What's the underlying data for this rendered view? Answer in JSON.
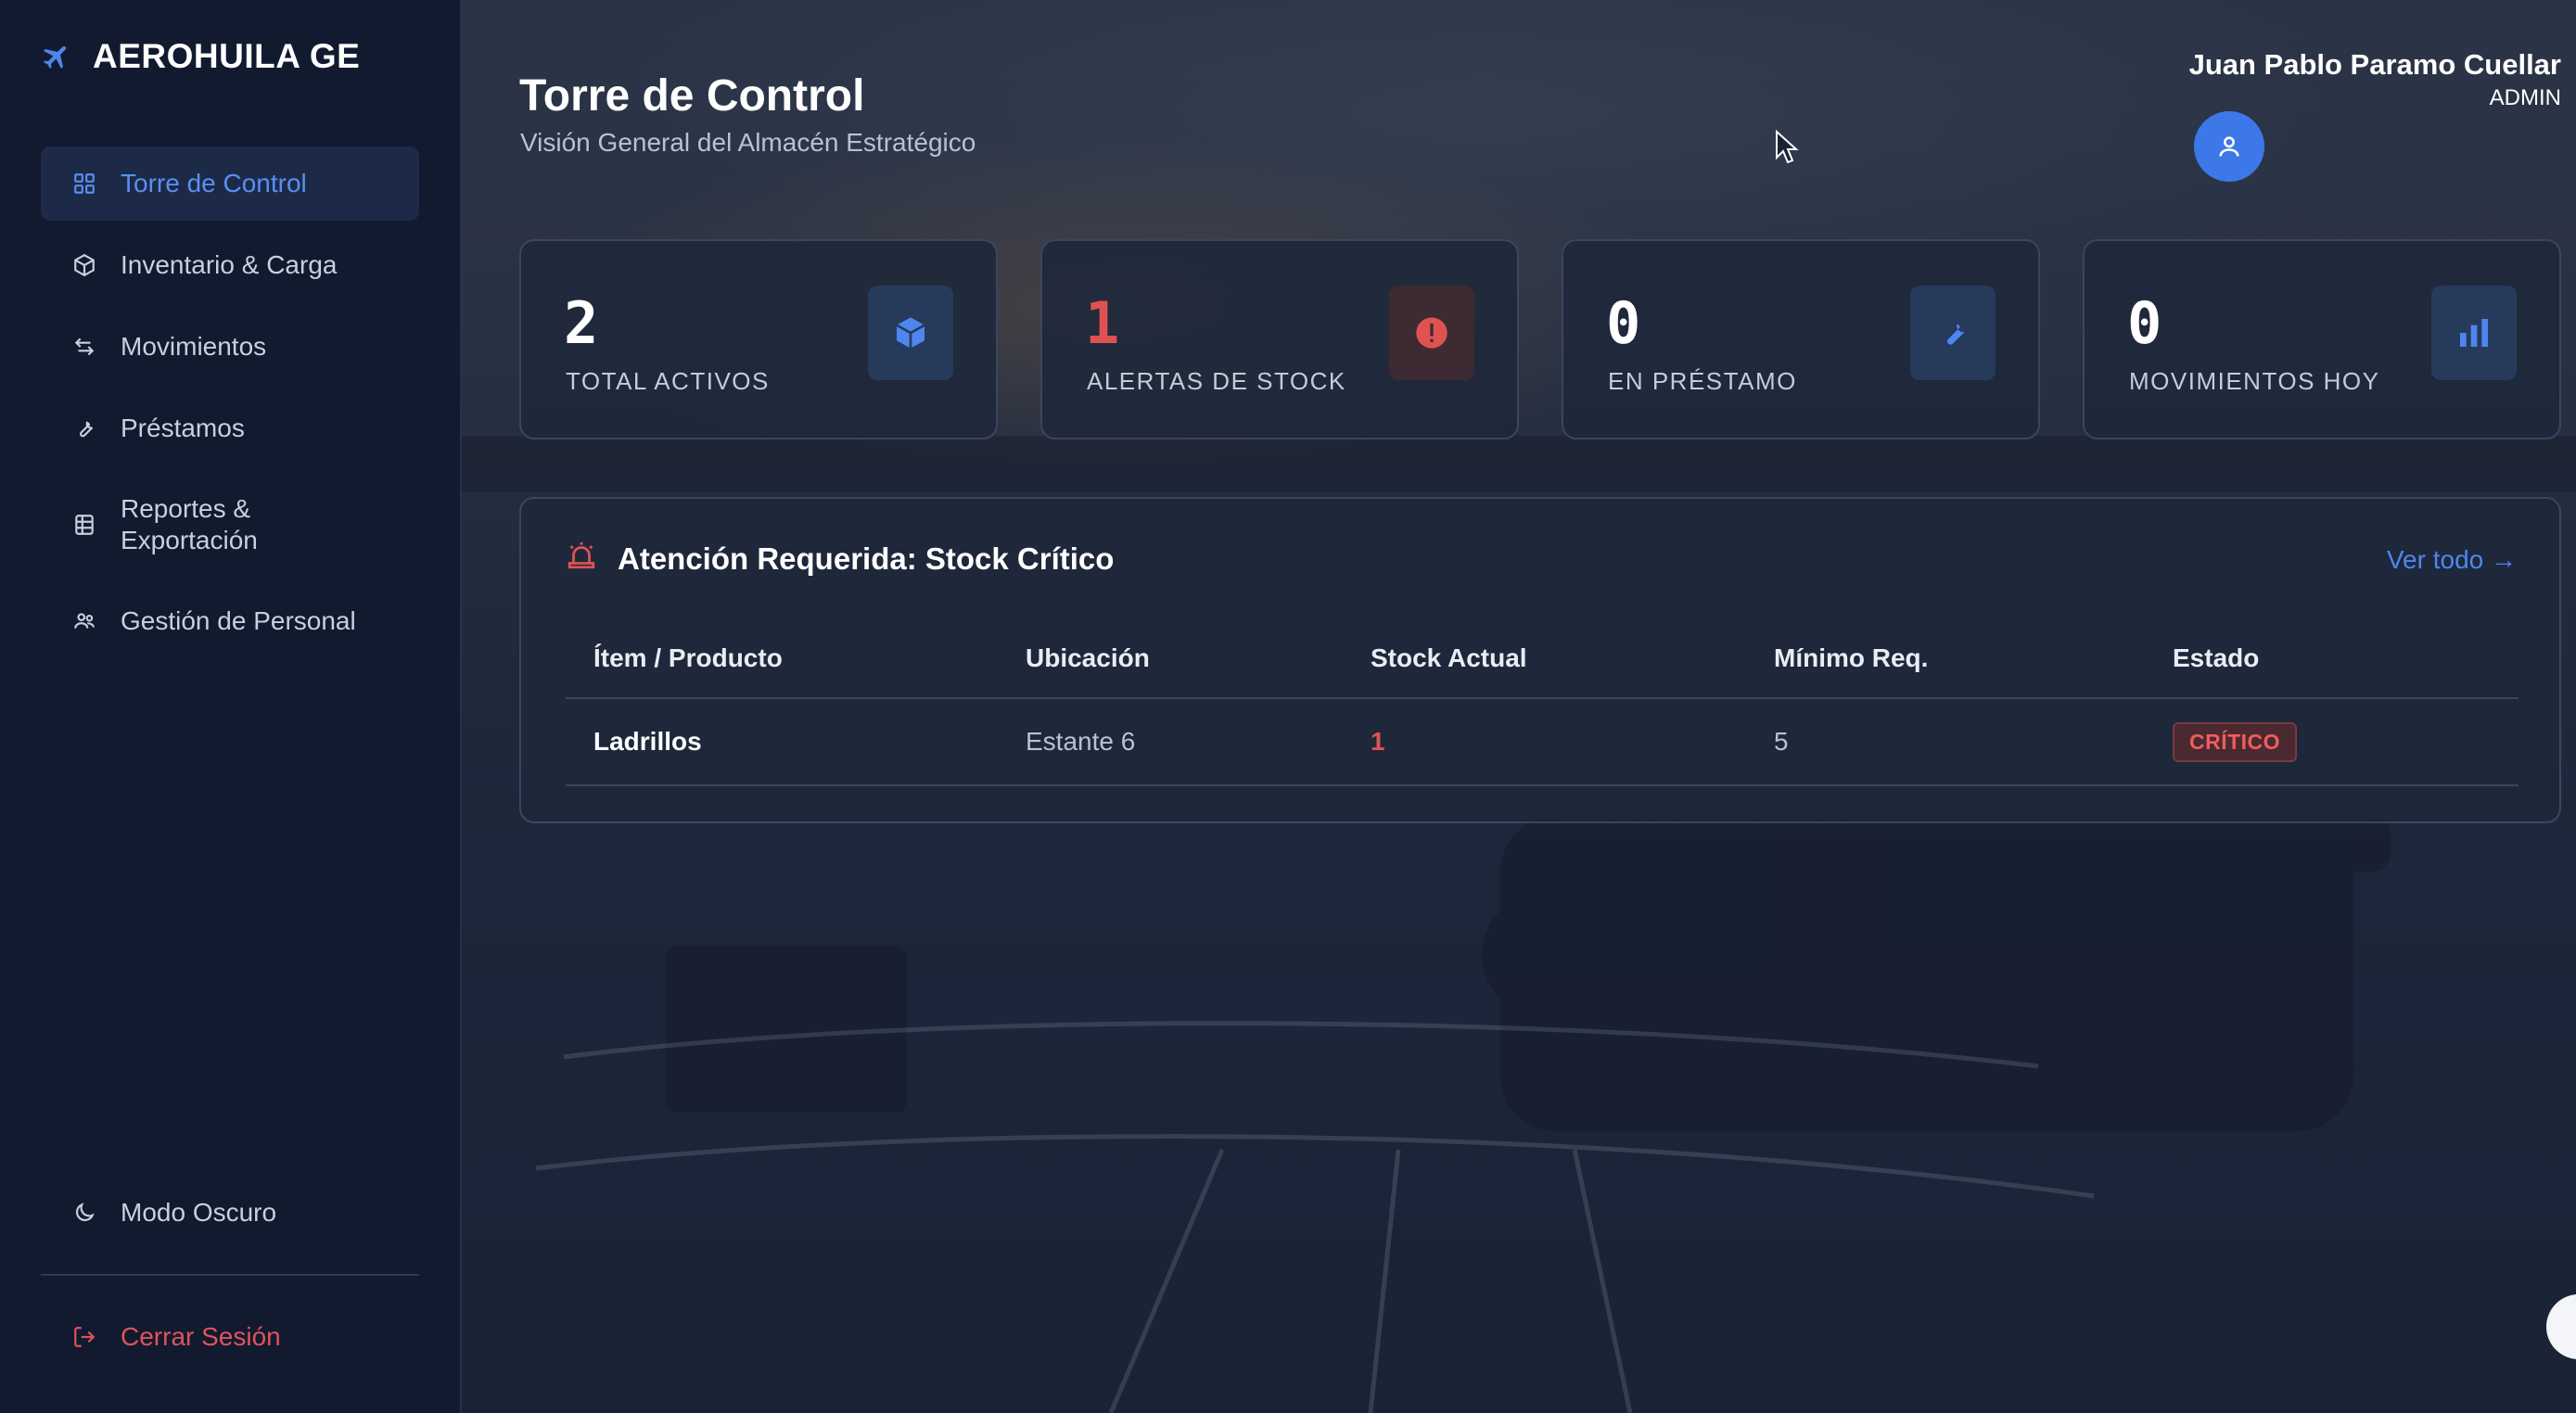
{
  "app": {
    "brand": "AEROHUILA GE"
  },
  "sidebar": {
    "items": [
      {
        "label": "Torre de Control",
        "icon": "grid-icon",
        "active": true
      },
      {
        "label": "Inventario & Carga",
        "icon": "box-icon"
      },
      {
        "label": "Movimientos",
        "icon": "arrows-icon"
      },
      {
        "label": "Préstamos",
        "icon": "wrench-icon"
      },
      {
        "label": "Reportes & Exportación",
        "icon": "spreadsheet-icon"
      },
      {
        "label": "Gestión de Personal",
        "icon": "users-icon"
      }
    ],
    "dark_mode_label": "Modo Oscuro",
    "logout_label": "Cerrar Sesión"
  },
  "header": {
    "title": "Torre de Control",
    "subtitle": "Visión General del Almacén Estratégico",
    "user_name": "Juan Pablo Paramo Cuellar",
    "user_role": "ADMIN"
  },
  "stats": [
    {
      "value": "2",
      "label": "TOTAL ACTIVOS",
      "icon": "box-icon",
      "alert": false
    },
    {
      "value": "1",
      "label": "ALERTAS DE STOCK",
      "icon": "alert-circle-icon",
      "alert": true
    },
    {
      "value": "0",
      "label": "EN PRÉSTAMO",
      "icon": "wrench-icon",
      "alert": false
    },
    {
      "value": "0",
      "label": "MOVIMIENTOS HOY",
      "icon": "bar-chart-icon",
      "alert": false
    }
  ],
  "alert_panel": {
    "title": "Atención Requerida: Stock Crítico",
    "see_all": "Ver todo →",
    "columns": [
      "Ítem / Producto",
      "Ubicación",
      "Stock Actual",
      "Mínimo Req.",
      "Estado"
    ],
    "rows": [
      {
        "item": "Ladrillos",
        "location": "Estante 6",
        "stock": "1",
        "minimum": "5",
        "status": "CRÍTICO"
      }
    ]
  },
  "colors": {
    "accent": "#3d78e8",
    "danger": "#e05252",
    "sidebar_bg": "#111a2f"
  }
}
